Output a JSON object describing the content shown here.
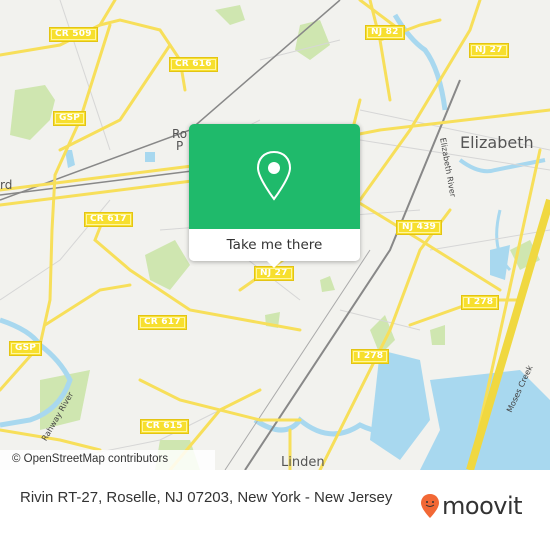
{
  "map": {
    "road_shields": [
      "CR 509",
      "CR 616",
      "NJ 82",
      "NJ 27",
      "GSP",
      "CR 617",
      "NJ 439",
      "NJ 27",
      "I 278",
      "CR 617",
      "GSP",
      "I 278",
      "CR 615"
    ],
    "places": [
      "Elizabeth",
      "Linden",
      "Ro",
      "P",
      "rd"
    ],
    "waterway_labels": [
      "Elizabeth River",
      "Rahway River",
      "Moses Creek"
    ],
    "attribution": "© OpenStreetMap contributors"
  },
  "popup": {
    "icon": "location-pin-icon",
    "action_label": "Take me there"
  },
  "footer": {
    "address": "Rivin RT-27, Roselle, NJ 07203, New York - New Jersey",
    "brand": "moovit",
    "brand_color": "#f26835"
  },
  "colors": {
    "accent": "#1fba6b",
    "road": "#f7df5a",
    "water": "#a8d8ef",
    "park": "#cfe8b0"
  }
}
